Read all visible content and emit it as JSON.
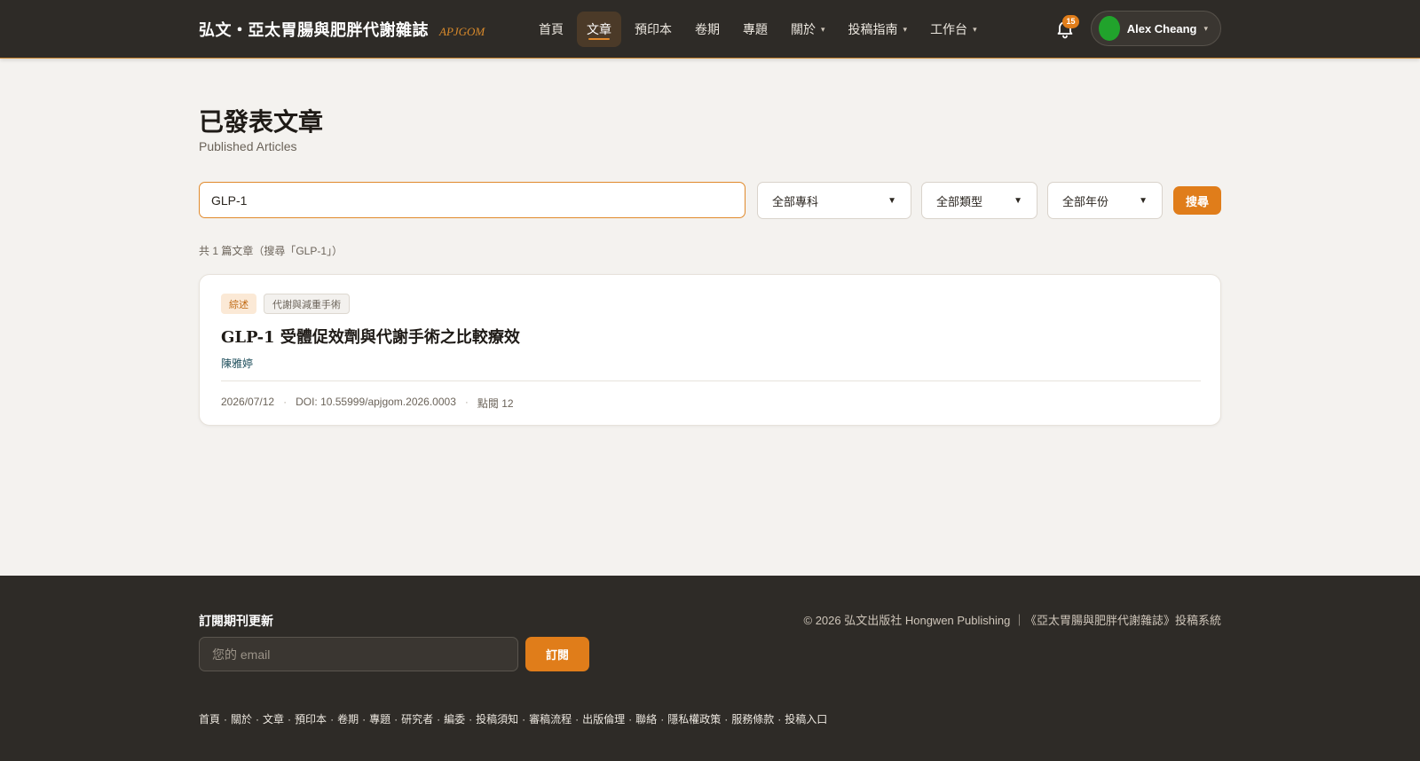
{
  "header": {
    "brand_title": "弘文・亞太胃腸與肥胖代謝雜誌",
    "brand_abbr": "APJGOM",
    "nav": [
      {
        "label": "首頁",
        "has_dropdown": false,
        "active": false
      },
      {
        "label": "文章",
        "has_dropdown": false,
        "active": true
      },
      {
        "label": "預印本",
        "has_dropdown": false,
        "active": false
      },
      {
        "label": "卷期",
        "has_dropdown": false,
        "active": false
      },
      {
        "label": "專題",
        "has_dropdown": false,
        "active": false
      },
      {
        "label": "關於",
        "has_dropdown": true,
        "active": false
      },
      {
        "label": "投稿指南",
        "has_dropdown": true,
        "active": false
      },
      {
        "label": "工作台",
        "has_dropdown": true,
        "active": false
      }
    ],
    "notification_count": "15",
    "user_name": "Alex Cheang"
  },
  "page": {
    "title": "已發表文章",
    "subtitle": "Published Articles"
  },
  "filters": {
    "search_value": "GLP-1",
    "specialty": "全部專科",
    "type": "全部類型",
    "year": "全部年份",
    "search_button": "搜尋"
  },
  "results": {
    "summary": "共 1 篇文章（搜尋「GLP-1」）",
    "articles": [
      {
        "type_tag": "綜述",
        "subject_tag": "代謝與減重手術",
        "title": "GLP-1 受體促效劑與代謝手術之比較療效",
        "author": "陳雅婷",
        "date": "2026/07/12",
        "doi": "DOI: 10.55999/apjgom.2026.0003",
        "views": "點閱 12"
      }
    ]
  },
  "footer": {
    "subscribe_title": "訂閱期刊更新",
    "email_placeholder": "您的 email",
    "subscribe_button": "訂閱",
    "copyright": "© 2026 弘文出版社 Hongwen Publishing ｜《亞太胃腸與肥胖代謝雜誌》投稿系統",
    "links": [
      "首頁",
      "關於",
      "文章",
      "預印本",
      "卷期",
      "專題",
      "研究者",
      "編委",
      "投稿須知",
      "審稿流程",
      "出版倫理",
      "聯絡",
      "隱私權政策",
      "服務條款",
      "投稿入口"
    ]
  },
  "colors": {
    "accent": "#e07d1a",
    "header_bg": "#2e2b27",
    "page_bg": "#f4f2ef",
    "avatar": "#21a32c"
  },
  "icons": {
    "notification": "bell-icon",
    "dropdown": "chevron-down-icon"
  }
}
